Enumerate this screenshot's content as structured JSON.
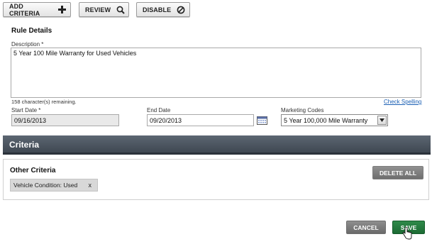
{
  "toolbar": {
    "add_criteria": "ADD CRITERIA",
    "review": "REVIEW",
    "disable": "DISABLE"
  },
  "rule_details": {
    "title": "Rule Details",
    "description_label": "Description *",
    "description_value": "5 Year 100 Mile Warranty for Used Vehicles",
    "remaining": "158 character(s) remaining.",
    "check_spelling": "Check Spelling",
    "start_date_label": "Start Date *",
    "start_date_value": "09/16/2013",
    "end_date_label": "End Date",
    "end_date_value": "09/20/2013",
    "marketing_codes_label": "Marketing Codes",
    "marketing_codes_value": "5 Year 100,000 Mile Warranty"
  },
  "criteria": {
    "header": "Criteria",
    "other_title": "Other Criteria",
    "delete_all": "DELETE ALL",
    "chips": [
      {
        "label": "Vehicle Condition: Used",
        "remove": "x"
      }
    ]
  },
  "footer": {
    "cancel": "CANCEL",
    "save": "SAVE"
  },
  "colors": {
    "criteria_bar": "#4a535d",
    "save_green": "#1f7a3a",
    "cancel_gray": "#7a7a7a",
    "link_blue": "#1a5fb4"
  },
  "icons": {
    "add": "plus-icon",
    "review": "search-icon",
    "disable": "ban-icon",
    "calendar": "calendar-icon",
    "dropdown": "chevron-down-icon",
    "cursor": "hand-pointer-icon"
  }
}
